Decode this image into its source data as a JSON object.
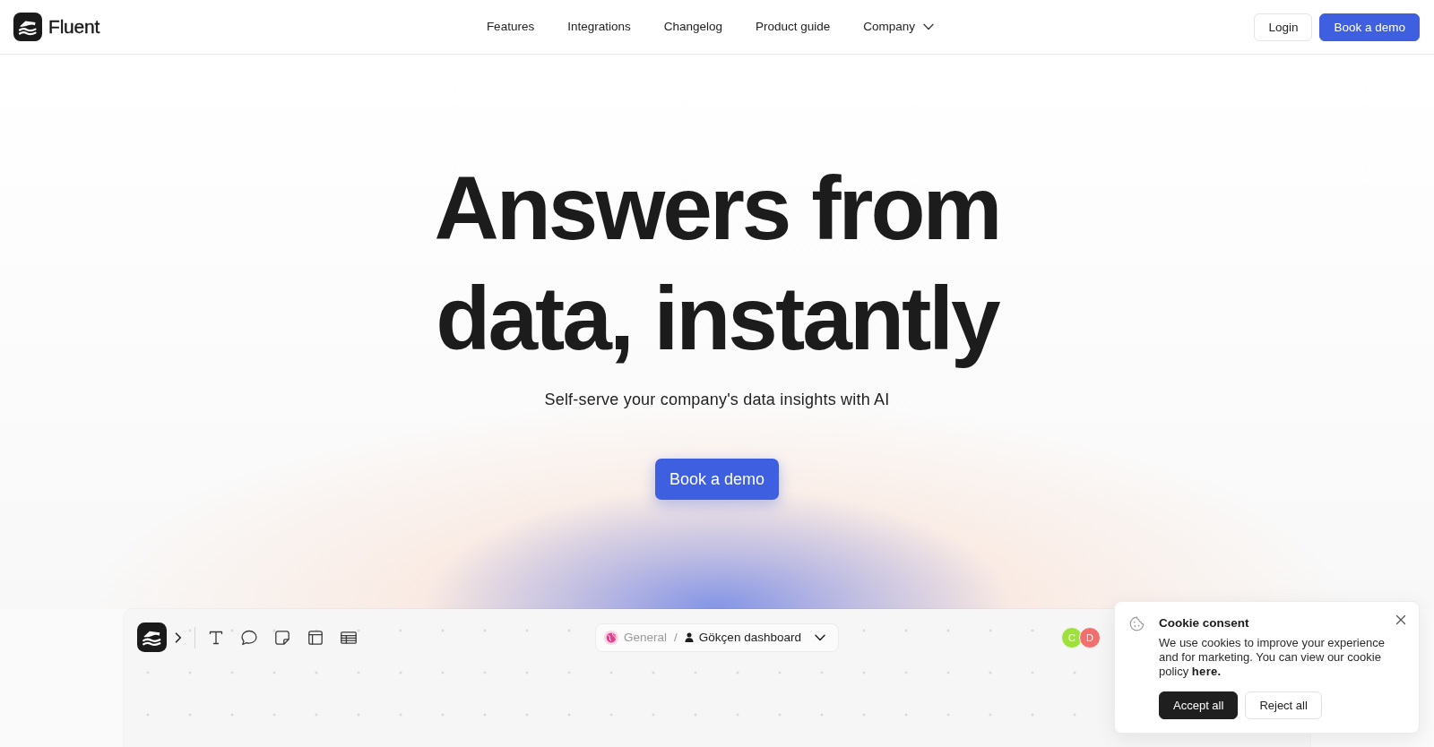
{
  "nav": {
    "brand": "Fluent",
    "links": [
      {
        "label": "Features",
        "kind": "link"
      },
      {
        "label": "Integrations",
        "kind": "link"
      },
      {
        "label": "Changelog",
        "kind": "link"
      },
      {
        "label": "Product guide",
        "kind": "link"
      },
      {
        "label": "Company",
        "kind": "dropdown"
      }
    ],
    "actions": [
      {
        "label": "Login",
        "kind": "secondary"
      },
      {
        "label": "Book a demo",
        "kind": "primary"
      }
    ]
  },
  "hero": {
    "title": "Answers from data, instantly",
    "subtitle": "Self-serve your company's data insights with AI",
    "cta": "Book a demo"
  },
  "app_preview": {
    "breadcrumb": {
      "workspace": "General",
      "separator": "/",
      "dashboard": "Gökçen dashboard"
    },
    "collaborators": [
      {
        "initial": "C",
        "color": "#9ee03c"
      },
      {
        "initial": "D",
        "color": "#f26f6f"
      }
    ]
  },
  "cookie_consent": {
    "title": "Cookie consent",
    "text": "We use cookies to improve your experience and for marketing. You can view our cookie policy",
    "link": "here.",
    "buttons": [
      {
        "label": "Accept all",
        "kind": "primary"
      },
      {
        "label": "Reject all",
        "kind": "secondary"
      }
    ]
  }
}
